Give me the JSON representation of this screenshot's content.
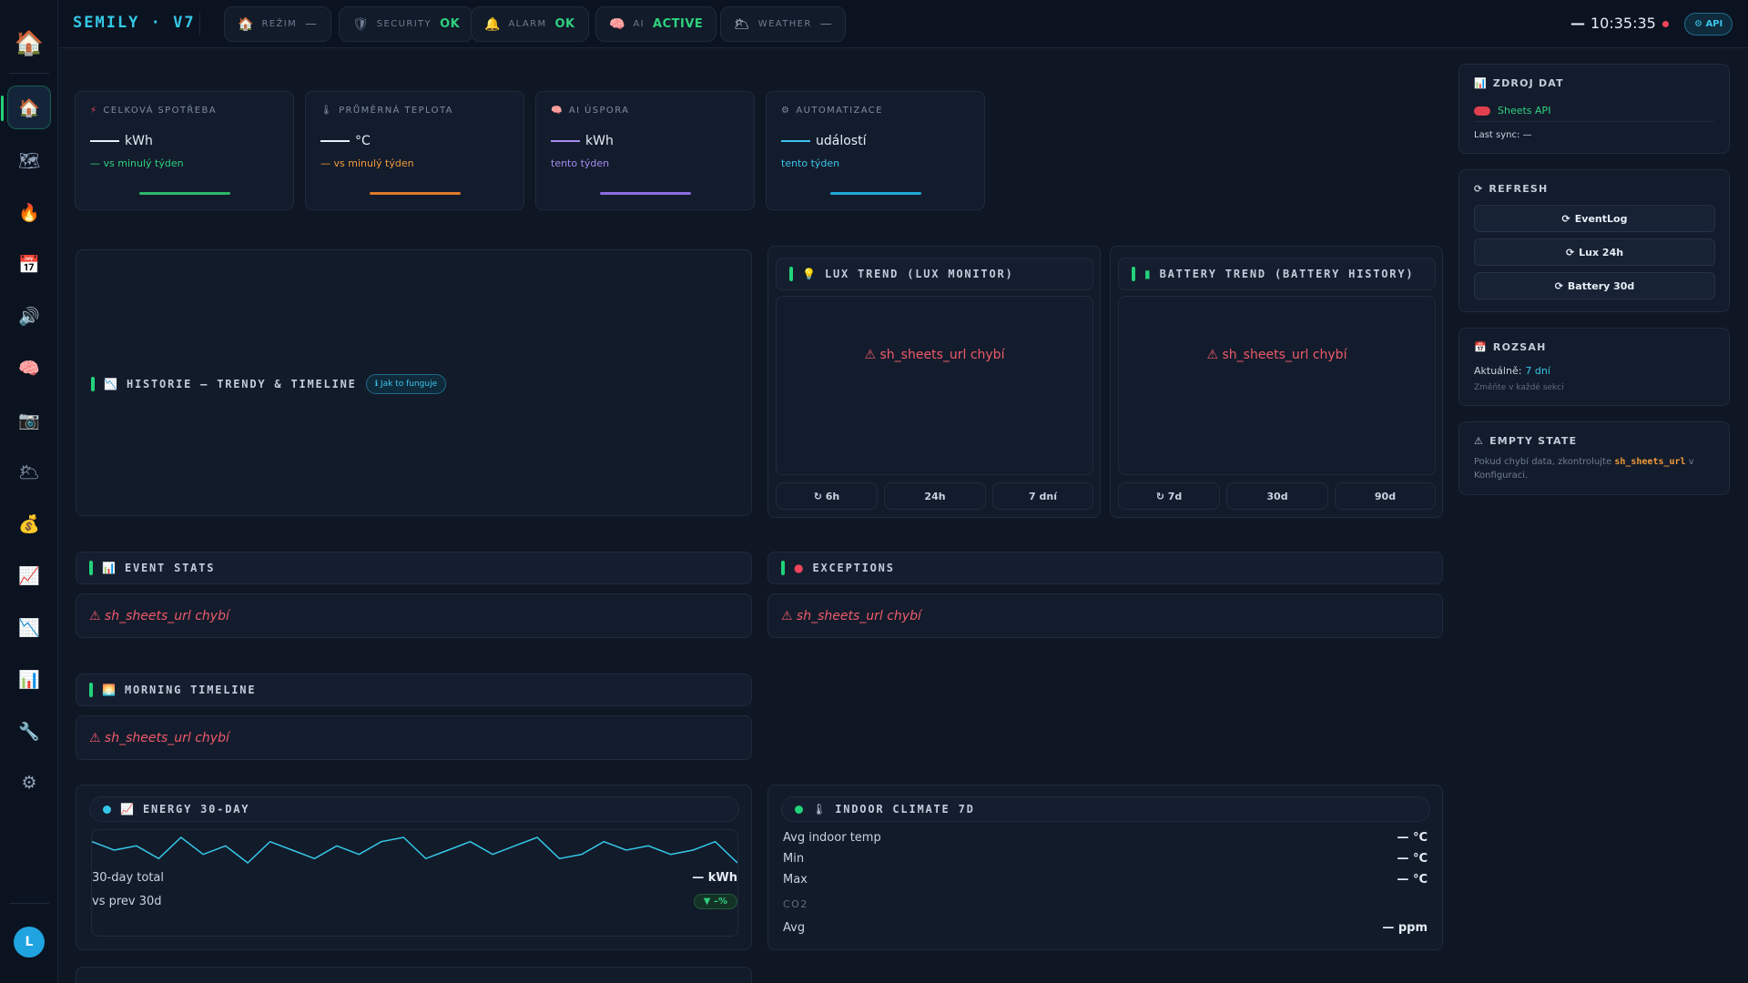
{
  "app": {
    "brand": "SEMILY · V7"
  },
  "topbar": {
    "chips": [
      {
        "icon": "🏠",
        "label": "REŽIM",
        "value": "—"
      },
      {
        "icon": "🛡",
        "label": "SECURITY",
        "value": "OK"
      },
      {
        "icon": "🔔",
        "label": "ALARM",
        "value": "OK"
      },
      {
        "icon": "🧠",
        "label": "AI",
        "value": "ACTIVE"
      },
      {
        "icon": "🌥",
        "label": "WEATHER",
        "value": "—"
      }
    ],
    "dash": "—",
    "clock": "10:35:35",
    "api_label": "⚙ API"
  },
  "kpis": [
    {
      "icon": "⚡",
      "title": "CELKOVÁ SPOTŘEBA",
      "unit": "kWh",
      "sub": "— vs minulý týden",
      "sub_color": "#2fd07e",
      "line_color": "#2fb86a"
    },
    {
      "icon": "🌡",
      "title": "PRŮMĚRNÁ TEPLOTA",
      "unit": "°C",
      "sub": "— vs minulý týden",
      "sub_color": "#f29a3a",
      "line_color": "#e07a2a"
    },
    {
      "icon": "🧠",
      "title": "AI ÚSPORA",
      "unit": "kWh",
      "sub": "tento týden",
      "sub_color": "#a48cf0",
      "line_color": "#8a6ee0"
    },
    {
      "icon": "⚙",
      "title": "AUTOMATIZACE",
      "unit": "událostí",
      "sub": "tento týden",
      "sub_color": "#3cc4ec",
      "line_color": "#22a8d8"
    }
  ],
  "history": {
    "title": "HISTORIE — TRENDY & TIMELINE",
    "info": "ℹ Jak to funguje"
  },
  "lux": {
    "title": "LUX TREND (LUX MONITOR)",
    "error": "⚠ sh_sheets_url chybí",
    "ranges": [
      "↻ 6h",
      "24h",
      "7 dní"
    ]
  },
  "battery": {
    "title": "BATTERY TREND (BATTERY HISTORY)",
    "error": "⚠ sh_sheets_url chybí",
    "ranges": [
      "↻ 7d",
      "30d",
      "90d"
    ]
  },
  "event_stats": {
    "title": "EVENT STATS",
    "error": "⚠ sh_sheets_url chybí"
  },
  "exceptions": {
    "title": "EXCEPTIONS",
    "error": "⚠ sh_sheets_url chybí"
  },
  "morning": {
    "title": "MORNING TIMELINE",
    "error": "⚠ sh_sheets_url chybí"
  },
  "energy": {
    "title": "ENERGY 30-DAY",
    "total_label": "30-day total",
    "total_value": "— kWh",
    "prev_label": "vs prev 30d",
    "prev_badge": "▼ –%",
    "spark": [
      14,
      12,
      13,
      10,
      15,
      11,
      13,
      9,
      14,
      12,
      10,
      13,
      11,
      14,
      15,
      10,
      12,
      14,
      11,
      13,
      15,
      10,
      11,
      14,
      12,
      13,
      11,
      12,
      14,
      9
    ]
  },
  "climate": {
    "title": "INDOOR CLIMATE 7D",
    "rows": [
      {
        "label": "Avg indoor temp",
        "value": "— °C"
      },
      {
        "label": "Min",
        "value": "— °C"
      },
      {
        "label": "Max",
        "value": "— °C"
      }
    ],
    "co2_label": "CO2",
    "co2_avg_label": "Avg",
    "co2_avg_value": "— ppm"
  },
  "rail": {
    "source": {
      "title": "ZDROJ DAT",
      "api": "Sheets API",
      "last_sync": "Last sync: —"
    },
    "refresh": {
      "title": "REFRESH",
      "buttons": [
        "EventLog",
        "Lux 24h",
        "Battery 30d"
      ]
    },
    "range": {
      "title": "ROZSAH",
      "current_label": "Aktuálně:",
      "current_value": "7 dní",
      "hint": "Změňte v každé sekci"
    },
    "empty": {
      "title": "EMPTY STATE",
      "text_before": "Pokud chybí data, zkontrolujte",
      "code": "sh_sheets_url",
      "text_after": "v Konfiguraci."
    }
  },
  "user": {
    "initial": "L"
  },
  "colors": {
    "accent_green": "#22d37a",
    "accent_cyan": "#35c8e8",
    "error": "#ee5a6a"
  }
}
